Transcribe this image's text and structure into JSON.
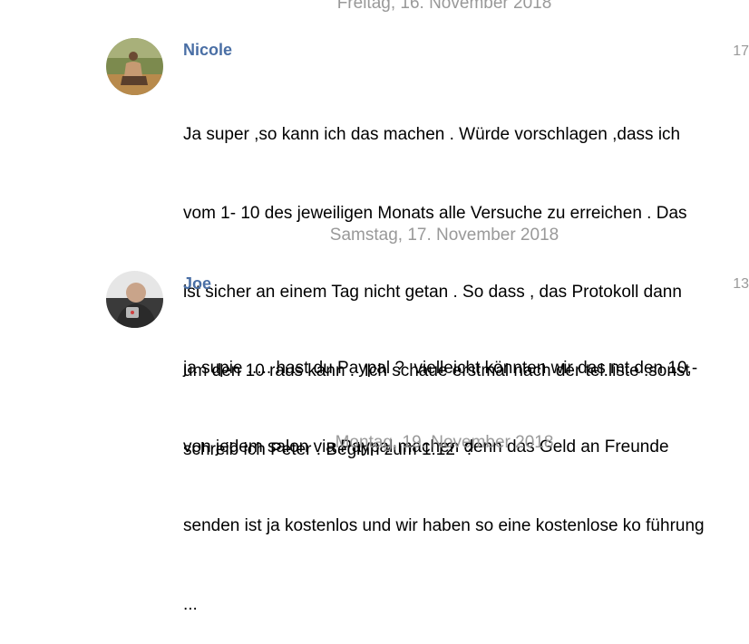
{
  "theme": {
    "author_color": "#4a6fa5",
    "date_color": "#999999",
    "text_color": "#000000"
  },
  "dates": {
    "d1": "Freitag, 16. November 2018",
    "d2": "Samstag, 17. November 2018",
    "d3": "Montag, 19. November 2018"
  },
  "messages": [
    {
      "author": "Nicole",
      "time": "17",
      "lines": [
        "Ja super ,so kann ich das machen . Würde vorschlagen ,dass ich",
        "vom 1- 10 des jeweiligen Monats alle Versuche zu erreichen . Das",
        "ist sicher an einem Tag nicht getan . So dass , das Protokoll dann",
        "um den 10 raus kann .  Ich schaue erstmal nach der tel.liste .sonst",
        "schreib ich Peter . Beginn zum 1.12  ?"
      ]
    },
    {
      "author": "Joe",
      "time": "13",
      "lines": [
        "ja supie ..... hast du Paypal ?  vielleicht könnten wir das mt den 10,-",
        "von jedem salon via Paypal machen denn das Geld an Freunde",
        "senden ist ja kostenlos und wir haben so eine kostenlose ko führung",
        "..."
      ]
    }
  ]
}
